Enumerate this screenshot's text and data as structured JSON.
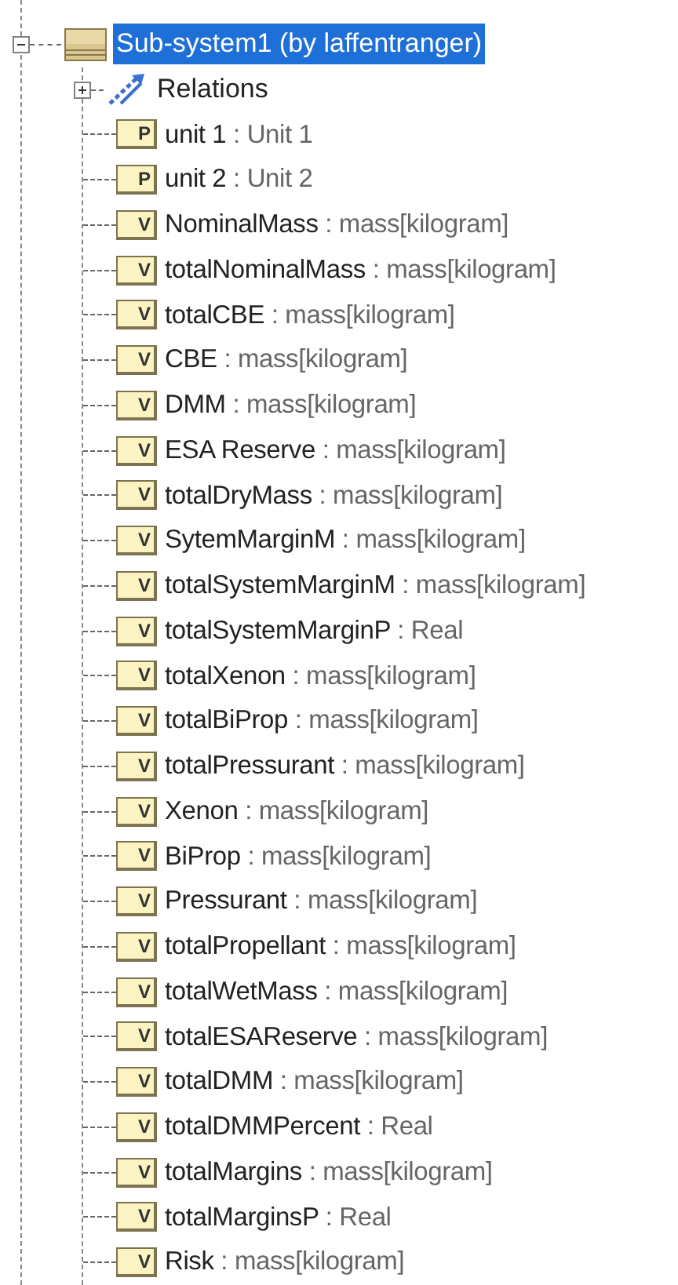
{
  "tree": {
    "label": "Sub-system1 (by laffentranger)",
    "selected": true,
    "expanded": true,
    "children": [
      {
        "kind": "relations",
        "label": "Relations",
        "expanded": false,
        "selected": false
      },
      {
        "kind": "part",
        "badge": "P",
        "name": "unit 1",
        "separator": ":",
        "type": "Unit 1",
        "selected": false
      },
      {
        "kind": "part",
        "badge": "P",
        "name": "unit 2",
        "separator": ":",
        "type": "Unit 2",
        "selected": false
      },
      {
        "kind": "value",
        "badge": "V",
        "name": "NominalMass",
        "separator": ":",
        "type": "mass[kilogram]",
        "selected": false
      },
      {
        "kind": "value",
        "badge": "V",
        "name": "totalNominalMass",
        "separator": ":",
        "type": "mass[kilogram]",
        "selected": false
      },
      {
        "kind": "value",
        "badge": "V",
        "name": "totalCBE",
        "separator": ":",
        "type": "mass[kilogram]",
        "selected": false
      },
      {
        "kind": "value",
        "badge": "V",
        "name": "CBE",
        "separator": ":",
        "type": "mass[kilogram]",
        "selected": false
      },
      {
        "kind": "value",
        "badge": "V",
        "name": "DMM",
        "separator": ":",
        "type": "mass[kilogram]",
        "selected": false
      },
      {
        "kind": "value",
        "badge": "V",
        "name": "ESA Reserve",
        "separator": ":",
        "type": "mass[kilogram]",
        "selected": false
      },
      {
        "kind": "value",
        "badge": "V",
        "name": "totalDryMass",
        "separator": ":",
        "type": "mass[kilogram]",
        "selected": false
      },
      {
        "kind": "value",
        "badge": "V",
        "name": "SytemMarginM",
        "separator": ":",
        "type": "mass[kilogram]",
        "selected": false
      },
      {
        "kind": "value",
        "badge": "V",
        "name": "totalSystemMarginM",
        "separator": ":",
        "type": "mass[kilogram]",
        "selected": false
      },
      {
        "kind": "value",
        "badge": "V",
        "name": "totalSystemMarginP",
        "separator": ":",
        "type": "Real",
        "selected": false
      },
      {
        "kind": "value",
        "badge": "V",
        "name": "totalXenon",
        "separator": ":",
        "type": "mass[kilogram]",
        "selected": false
      },
      {
        "kind": "value",
        "badge": "V",
        "name": "totalBiProp",
        "separator": ":",
        "type": "mass[kilogram]",
        "selected": false
      },
      {
        "kind": "value",
        "badge": "V",
        "name": "totalPressurant",
        "separator": ":",
        "type": "mass[kilogram]",
        "selected": false
      },
      {
        "kind": "value",
        "badge": "V",
        "name": "Xenon",
        "separator": ":",
        "type": "mass[kilogram]",
        "selected": false
      },
      {
        "kind": "value",
        "badge": "V",
        "name": "BiProp",
        "separator": ":",
        "type": "mass[kilogram]",
        "selected": false
      },
      {
        "kind": "value",
        "badge": "V",
        "name": "Pressurant",
        "separator": ":",
        "type": "mass[kilogram]",
        "selected": false
      },
      {
        "kind": "value",
        "badge": "V",
        "name": "totalPropellant",
        "separator": ":",
        "type": "mass[kilogram]",
        "selected": false
      },
      {
        "kind": "value",
        "badge": "V",
        "name": "totalWetMass",
        "separator": ":",
        "type": "mass[kilogram]",
        "selected": false
      },
      {
        "kind": "value",
        "badge": "V",
        "name": "totalESAReserve",
        "separator": ":",
        "type": "mass[kilogram]",
        "selected": false
      },
      {
        "kind": "value",
        "badge": "V",
        "name": "totalDMM",
        "separator": ":",
        "type": "mass[kilogram]",
        "selected": false
      },
      {
        "kind": "value",
        "badge": "V",
        "name": "totalDMMPercent",
        "separator": ":",
        "type": "Real",
        "selected": false
      },
      {
        "kind": "value",
        "badge": "V",
        "name": "totalMargins",
        "separator": ":",
        "type": "mass[kilogram]",
        "selected": false
      },
      {
        "kind": "value",
        "badge": "V",
        "name": "totalMarginsP",
        "separator": ":",
        "type": "Real",
        "selected": false
      },
      {
        "kind": "value",
        "badge": "V",
        "name": "Risk",
        "separator": ":",
        "type": "mass[kilogram]",
        "selected": false
      }
    ]
  }
}
